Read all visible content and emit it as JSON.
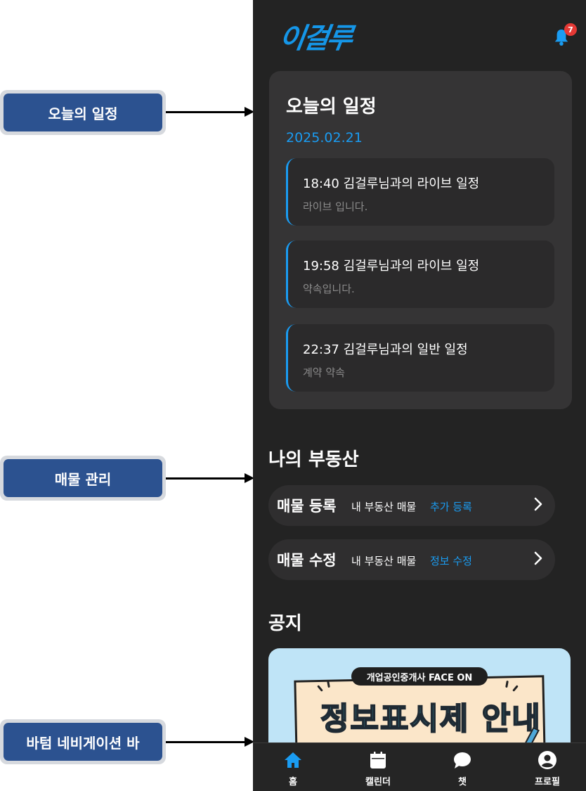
{
  "callouts": {
    "schedule": "오늘의 일정",
    "property": "매물 관리",
    "bottom_nav": "바텀 네비게이션 바"
  },
  "app": {
    "logo": "이걸루",
    "notification_count": "7",
    "accent_color": "#1a9cf2"
  },
  "schedule": {
    "title": "오늘의 일정",
    "date": "2025.02.21",
    "events": [
      {
        "title": "18:40 김걸루님과의 라이브 일정",
        "subtitle": "라이브 입니다."
      },
      {
        "title": "19:58 김걸루님과의 라이브 일정",
        "subtitle": "약속입니다."
      },
      {
        "title": "22:37 김걸루님과의 일반 일정",
        "subtitle": "계약 약속"
      }
    ]
  },
  "property": {
    "title": "나의 부동산",
    "items": [
      {
        "label": "매물 등록",
        "desc": "내 부동산 매물",
        "accent": "추가 등록"
      },
      {
        "label": "매물 수정",
        "desc": "내 부동산 매물",
        "accent": "정보 수정"
      }
    ]
  },
  "notice": {
    "title": "공지",
    "banner_tag": "개업공인중개사 FACE ON",
    "banner_headline": "정보표시제 안내"
  },
  "bottom_nav": {
    "items": [
      {
        "label": "홈",
        "icon": "home-icon",
        "active": true
      },
      {
        "label": "캘린더",
        "icon": "calendar-icon",
        "active": false
      },
      {
        "label": "챗",
        "icon": "chat-icon",
        "active": false
      },
      {
        "label": "프로필",
        "icon": "profile-icon",
        "active": false
      }
    ]
  }
}
